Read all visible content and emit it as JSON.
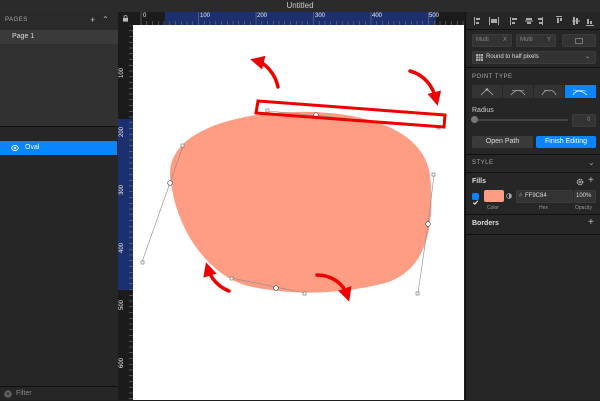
{
  "window": {
    "title": "Untitled"
  },
  "sidebar": {
    "pages_header": "PAGES",
    "add_icon": "plus-icon",
    "collapse_icon": "chevron-up-icon",
    "pages": [
      {
        "label": "Page 1"
      }
    ],
    "layers": [
      {
        "label": "Oval",
        "icon": "oval-icon",
        "selected": true
      }
    ],
    "filter": {
      "label": "Filter",
      "icon": "filter-icon"
    }
  },
  "rulers": {
    "top_ticks": [
      "0",
      "100",
      "200",
      "300",
      "400",
      "500"
    ],
    "left_ticks": [
      "100",
      "200",
      "300",
      "400",
      "500",
      "600"
    ]
  },
  "inspector": {
    "size_fields": [
      {
        "value": "Multi",
        "unit": "X"
      },
      {
        "value": "Multi",
        "unit": "Y"
      }
    ],
    "rounding_select": "Round to half pixels",
    "point_type": {
      "label": "POINT TYPE",
      "options": [
        "Straight",
        "Mirrored",
        "Disconnected",
        "Asymmetric"
      ],
      "selected_index": 3
    },
    "radius": {
      "label": "Radius",
      "value": "0"
    },
    "open_path_button": "Open Path",
    "finish_editing_button": "Finish Editing",
    "style_header": "STYLE",
    "fills": {
      "label": "Fills",
      "items": [
        {
          "enabled": true,
          "color": "#FF9C84",
          "hex": "FF9C84",
          "opacity": "100%"
        }
      ],
      "column_labels": {
        "color": "Color",
        "hex": "Hex",
        "opacity": "Opacity"
      }
    },
    "borders_label": "Borders"
  },
  "colors": {
    "accent": "#0A84FF",
    "fill": "#FF9C84",
    "annotation": "#EE0000"
  }
}
